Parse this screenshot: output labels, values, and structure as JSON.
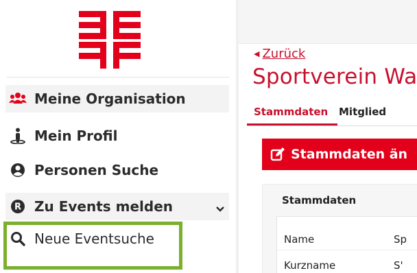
{
  "sidebar": {
    "items": [
      {
        "label": "Meine Organisation",
        "icon": "users-icon"
      },
      {
        "label": "Mein Profil",
        "icon": "person-standing-icon"
      },
      {
        "label": "Personen Suche",
        "icon": "user-circle-icon"
      },
      {
        "label": "Zu Events melden",
        "icon": "r-circle-icon"
      },
      {
        "label": "Neue Eventsuche",
        "icon": "search-icon"
      }
    ],
    "highlight_color": "#7ab02c"
  },
  "main": {
    "back_label": "Zurück",
    "title": "Sportverein Wa",
    "tabs": [
      {
        "label": "Stammdaten",
        "active": true
      },
      {
        "label": "Mitglied",
        "active": false
      }
    ],
    "edit_button_label": "Stammdaten än",
    "card": {
      "title": "Stammdaten",
      "rows": [
        {
          "label": "Name",
          "value": "Sp"
        },
        {
          "label": "Kurzname",
          "value": "S'"
        }
      ]
    }
  },
  "colors": {
    "brand_red": "#e2001a",
    "link_red": "#c8102e",
    "highlight_green": "#7ab02c"
  }
}
